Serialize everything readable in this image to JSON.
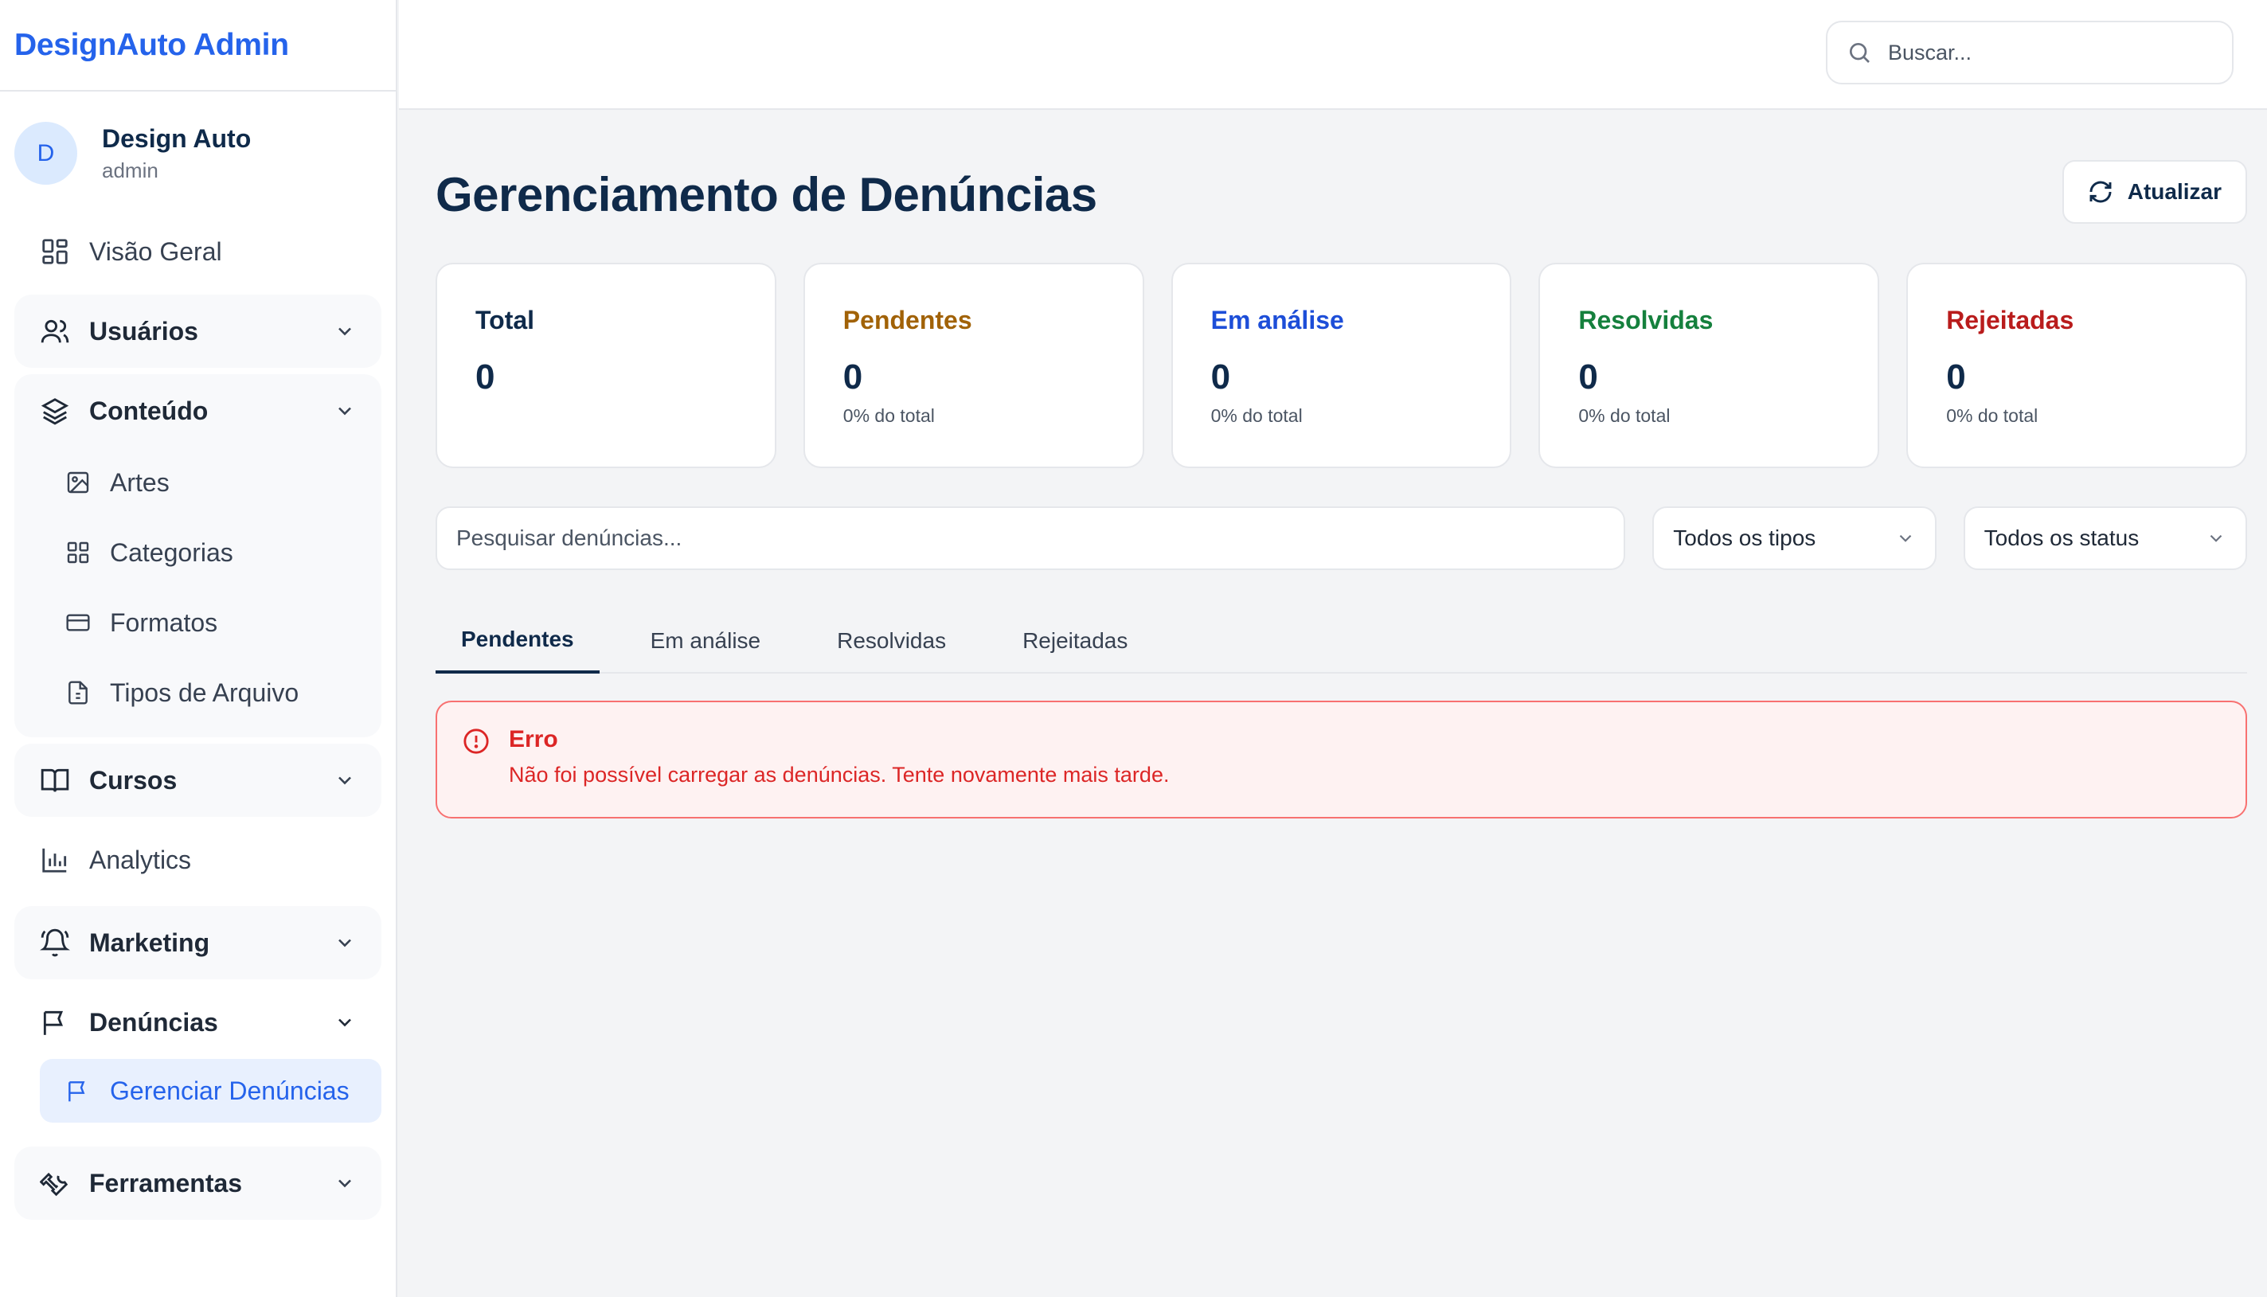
{
  "app": {
    "brand": "DesignAuto Admin"
  },
  "user": {
    "initial": "D",
    "name": "Design Auto",
    "role": "admin"
  },
  "sidebar": {
    "overview": "Visão Geral",
    "users": "Usuários",
    "content": {
      "label": "Conteúdo",
      "items": [
        "Artes",
        "Categorias",
        "Formatos",
        "Tipos de Arquivo"
      ]
    },
    "courses": "Cursos",
    "analytics": "Analytics",
    "marketing": "Marketing",
    "reports": {
      "label": "Denúncias",
      "active_item": "Gerenciar Denúncias"
    },
    "tools": "Ferramentas"
  },
  "topbar": {
    "search_placeholder": "Buscar..."
  },
  "page": {
    "title": "Gerenciamento de Denúncias",
    "refresh_label": "Atualizar"
  },
  "stats": [
    {
      "label": "Total",
      "value": "0",
      "sub": "",
      "color": "#0f2a4a"
    },
    {
      "label": "Pendentes",
      "value": "0",
      "sub": "0% do total",
      "color": "#a16207"
    },
    {
      "label": "Em análise",
      "value": "0",
      "sub": "0% do total",
      "color": "#1d4ed8"
    },
    {
      "label": "Resolvidas",
      "value": "0",
      "sub": "0% do total",
      "color": "#15803d"
    },
    {
      "label": "Rejeitadas",
      "value": "0",
      "sub": "0% do total",
      "color": "#b91c1c"
    }
  ],
  "filters": {
    "search_placeholder": "Pesquisar denúncias...",
    "type_selected": "Todos os tipos",
    "status_selected": "Todos os status"
  },
  "tabs": [
    "Pendentes",
    "Em análise",
    "Resolvidas",
    "Rejeitadas"
  ],
  "alert": {
    "title": "Erro",
    "message": "Não foi possível carregar as denúncias. Tente novamente mais tarde."
  }
}
